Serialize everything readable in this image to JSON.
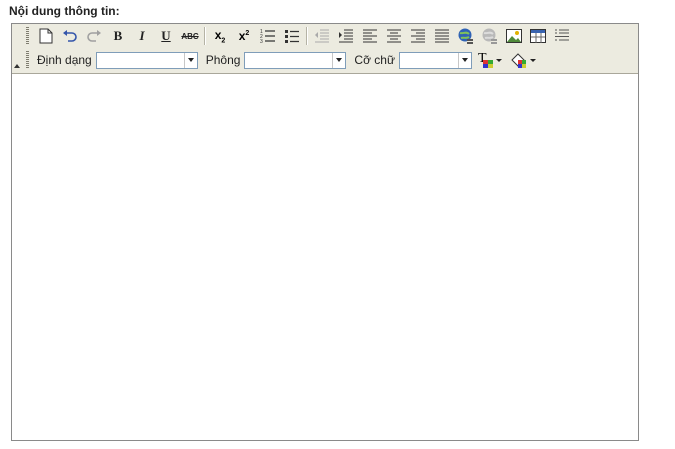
{
  "label": "Nội dung thông tin:",
  "toolbar": {
    "row1_icons": [
      "new-document-icon",
      "undo-icon",
      "redo-icon",
      "bold",
      "italic",
      "underline",
      "strikethrough",
      "subscript-icon",
      "superscript-icon",
      "ordered-list-icon",
      "unordered-list-icon",
      "outdent-icon",
      "indent-icon",
      "align-left-icon",
      "align-center-icon",
      "align-right-icon",
      "justify-icon",
      "insert-link-icon",
      "unlink-icon",
      "insert-image-icon",
      "insert-table-icon",
      "horizontal-rule-icon"
    ],
    "bold_label": "B",
    "italic_label": "I",
    "underline_label": "U",
    "strike_label": "ABC",
    "sub_label": "x",
    "sup_label": "x",
    "format_label": "Định dạng",
    "format_value": "",
    "font_label": "Phông",
    "font_value": "",
    "size_label": "Cỡ chữ",
    "size_value": "",
    "text_color_label": "T",
    "colors": {
      "toolbar_bg": "#ecebe0",
      "border": "#8a8a8a"
    }
  }
}
